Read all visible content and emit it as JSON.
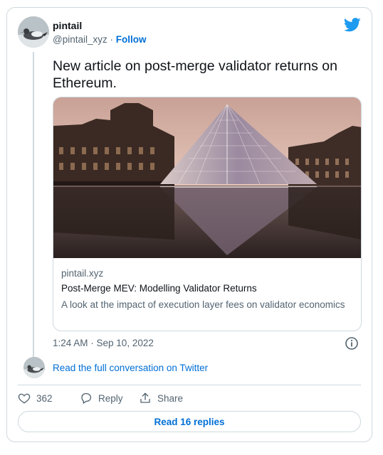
{
  "author": {
    "name": "pintail",
    "handle": "@pintail_xyz",
    "separator": "·",
    "follow_label": "Follow"
  },
  "tweet": {
    "text": "New article on post-merge validator returns on Ethereum.",
    "timestamp": "1:24 AM · Sep 10, 2022"
  },
  "link_card": {
    "domain": "pintail.xyz",
    "title": "Post-Merge MEV: Modelling Validator Returns",
    "description": "A look at the impact of execution layer fees on validator economics"
  },
  "conversation": {
    "read_full_label": "Read the full conversation on Twitter"
  },
  "actions": {
    "like_count": "362",
    "reply_label": "Reply",
    "share_label": "Share"
  },
  "replies_button": {
    "label": "Read 16 replies"
  },
  "icons": {
    "brand": "twitter-bird-icon",
    "info": "info-icon",
    "like": "heart-icon",
    "reply": "reply-icon",
    "share": "share-icon"
  },
  "colors": {
    "accent": "#1d9bf0",
    "link": "#006fd6",
    "text_primary": "#0f1419",
    "text_secondary": "#536471",
    "border": "#cfd9de"
  }
}
